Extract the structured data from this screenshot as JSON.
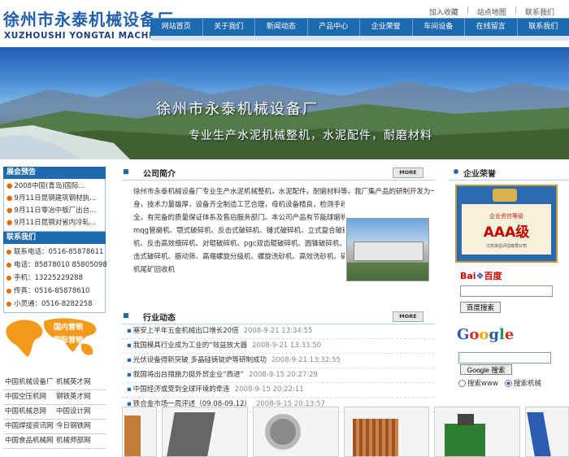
{
  "header": {
    "logo_cn": "徐州市永泰机械设备厂",
    "logo_en": "XUZHOUSHI YONGTAI MACHINERY",
    "top_links": [
      "加入收藏",
      "站点地图",
      "联系我们"
    ],
    "nav": [
      "网站首页",
      "关于我们",
      "新闻动态",
      "产品中心",
      "企业荣誉",
      "车间设备",
      "在线留言",
      "联系我们"
    ]
  },
  "banner": {
    "title": "徐州市永泰机械设备厂",
    "subtitle": "专业生产水泥机械整机，水泥配件，耐磨材料"
  },
  "left": {
    "expo_title": "展会预告",
    "expo_items": [
      "2008中国(青岛)国际...",
      "9月11日昆钢建筑钢材执...",
      "9月11日零冶中板厂出台...",
      "9月11日昆钢对省内冷轧..."
    ],
    "contact_title": "联系我们",
    "contact_items": [
      "联系电话：0516-85878611",
      "电话：85878010 85805098",
      "手机：13225229288",
      "传真：0516-85878610",
      "小灵通：0516-8282258"
    ],
    "map_labels": [
      "国内营销",
      "国际营销"
    ],
    "links": [
      [
        "中国机械设备厂",
        "机械英才网"
      ],
      [
        "中国空压机网",
        "钢铁英才网"
      ],
      [
        "中国机械总网",
        "中国设计网"
      ],
      [
        "中国焊接资讯网",
        "今日钢铁网"
      ],
      [
        "中国食品机械网",
        "机械师部网"
      ]
    ]
  },
  "intro": {
    "title": "公司简介",
    "more": "MORE",
    "lines": [
      "徐州市永泰机械设备厂专业生产水泥机械整机，水泥配件，耐磨材料等。我厂集产品的研制开发为一",
      "身，技术力量雄厚，设备齐全制造工艺合理，母机设备精良，检测手段齐",
      "全，有完备的质量保证体系及售后服务部门。本公司产品有节能球磨机、",
      "mqg管磨机、颚式破碎机、反击式破碎机、锤式破碎机、立式复合破碎",
      "机、反击高效细碎机、对辊破碎机、pgc双齿辊破碎机、圆锥破碎机、冲",
      "击式破碎机、振动筛、高堰螺旋分级机、螺旋洗砂机、高效洗砂机、磁选",
      "机尾矿回收机"
    ]
  },
  "industry": {
    "title": "行业动态",
    "more": "MORE",
    "items": [
      {
        "title": "塞安上半年五金机械出口增长20倍",
        "date": "2008-9-21 13:34:55"
      },
      {
        "title": "我国模具行业成为工业的“效益放大器",
        "date": "2008-9-21 13:33:50"
      },
      {
        "title": "光伏设备得新突破 多晶硅铸锭炉等研制成功",
        "date": "2008-9-21 13:32:55"
      },
      {
        "title": "我国将出台措施力挺外贸企业“西进”",
        "date": "2008-9-15 20:27:29"
      },
      {
        "title": "中国经济或受到全球环境的牵连",
        "date": "2008-9-15 20:22:11"
      },
      {
        "title": "铁合金市场一周评述（09.08-09.12）",
        "date": "2008-9-15 20:13:57"
      }
    ]
  },
  "right": {
    "honor_title": "企业荣誉",
    "cert_text": "企业资信等级",
    "cert_grade": "AAA级",
    "cert_small": "江苏资信评估有限公司",
    "baidu_logo_a": "Bai",
    "baidu_logo_b": "百度",
    "baidu_button": "百度搜索",
    "google_logo": [
      "G",
      "o",
      "o",
      "g",
      "l",
      "e"
    ],
    "google_button": "Google 搜索",
    "radio_www": "搜索www",
    "radio_site": "搜索机械"
  },
  "colors": {
    "nav_blue": "#1e6ab0",
    "accent_orange": "#e56b00"
  }
}
